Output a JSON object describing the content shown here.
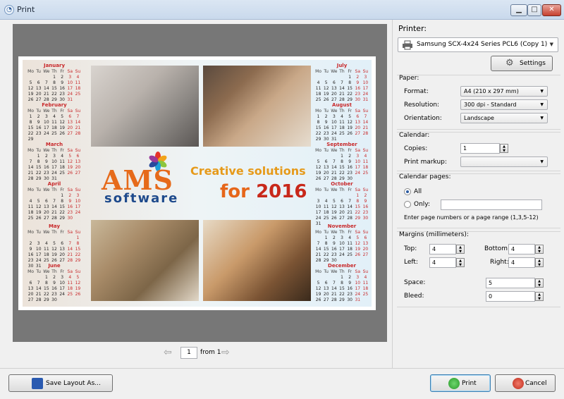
{
  "window": {
    "title": "Print",
    "controls": {
      "minimize": "▁",
      "maximize": "□",
      "close": "✕"
    }
  },
  "calendar_preview": {
    "brand_main": "AMS",
    "brand_sub": "software",
    "slogan_line1": "Creative solutions",
    "slogan_line2_prefix": "for ",
    "slogan_year": "2016",
    "weekday_header": [
      "Mo",
      "Tu",
      "We",
      "Th",
      "Fr",
      "Sa",
      "Su"
    ],
    "months": [
      {
        "name": "January",
        "side": "left",
        "row": 0,
        "offset": 3,
        "days": 31
      },
      {
        "name": "February",
        "side": "left",
        "row": 1,
        "offset": 0,
        "days": 29
      },
      {
        "name": "March",
        "side": "left",
        "row": 2,
        "offset": 1,
        "days": 31
      },
      {
        "name": "April",
        "side": "left",
        "row": 3,
        "offset": 4,
        "days": 30
      },
      {
        "name": "May",
        "side": "left",
        "row": 4,
        "offset": 6,
        "days": 31
      },
      {
        "name": "June",
        "side": "left",
        "row": 5,
        "offset": 2,
        "days": 30
      },
      {
        "name": "July",
        "side": "right",
        "row": 0,
        "offset": 4,
        "days": 31
      },
      {
        "name": "August",
        "side": "right",
        "row": 1,
        "offset": 0,
        "days": 31
      },
      {
        "name": "September",
        "side": "right",
        "row": 2,
        "offset": 3,
        "days": 30
      },
      {
        "name": "October",
        "side": "right",
        "row": 3,
        "offset": 5,
        "days": 31
      },
      {
        "name": "November",
        "side": "right",
        "row": 4,
        "offset": 1,
        "days": 30
      },
      {
        "name": "December",
        "side": "right",
        "row": 5,
        "offset": 3,
        "days": 31
      }
    ]
  },
  "pager": {
    "current_page": "1",
    "from_label": "from 1"
  },
  "panel": {
    "printer_label": "Printer:",
    "printer_value": "Samsung SCX-4x24 Series PCL6 (Copy 1)",
    "settings_label": "Settings",
    "paper": {
      "title": "Paper:",
      "format_label": "Format:",
      "format_value": "A4 (210 x 297 mm)",
      "resolution_label": "Resolution:",
      "resolution_value": "300 dpi - Standard",
      "orientation_label": "Orientation:",
      "orientation_value": "Landscape"
    },
    "calendar": {
      "title": "Calendar:",
      "copies_label": "Copies:",
      "copies_value": "1",
      "markup_label": "Print markup:",
      "markup_value": ""
    },
    "pages": {
      "title": "Calendar pages:",
      "all_label": "All",
      "only_label": "Only:",
      "only_value": "",
      "hint": "Enter page numbers or a page range (1,3,5-12)",
      "selected": "all"
    },
    "margins": {
      "title": "Margins (millimeters):",
      "top_label": "Top:",
      "top_value": "4",
      "bottom_label": "Bottom:",
      "bottom_value": "4",
      "left_label": "Left:",
      "left_value": "4",
      "right_label": "Right:",
      "right_value": "4",
      "space_label": "Space:",
      "space_value": "5",
      "bleed_label": "Bleed:",
      "bleed_value": "0"
    }
  },
  "buttons": {
    "save_layout": "Save Layout As...",
    "print": "Print",
    "cancel": "Cancel"
  },
  "colors": {
    "preview_bg": "#777777",
    "accent_red": "#c8282a",
    "brand_orange": "#e66a1a",
    "brand_blue": "#1e4a8c"
  }
}
